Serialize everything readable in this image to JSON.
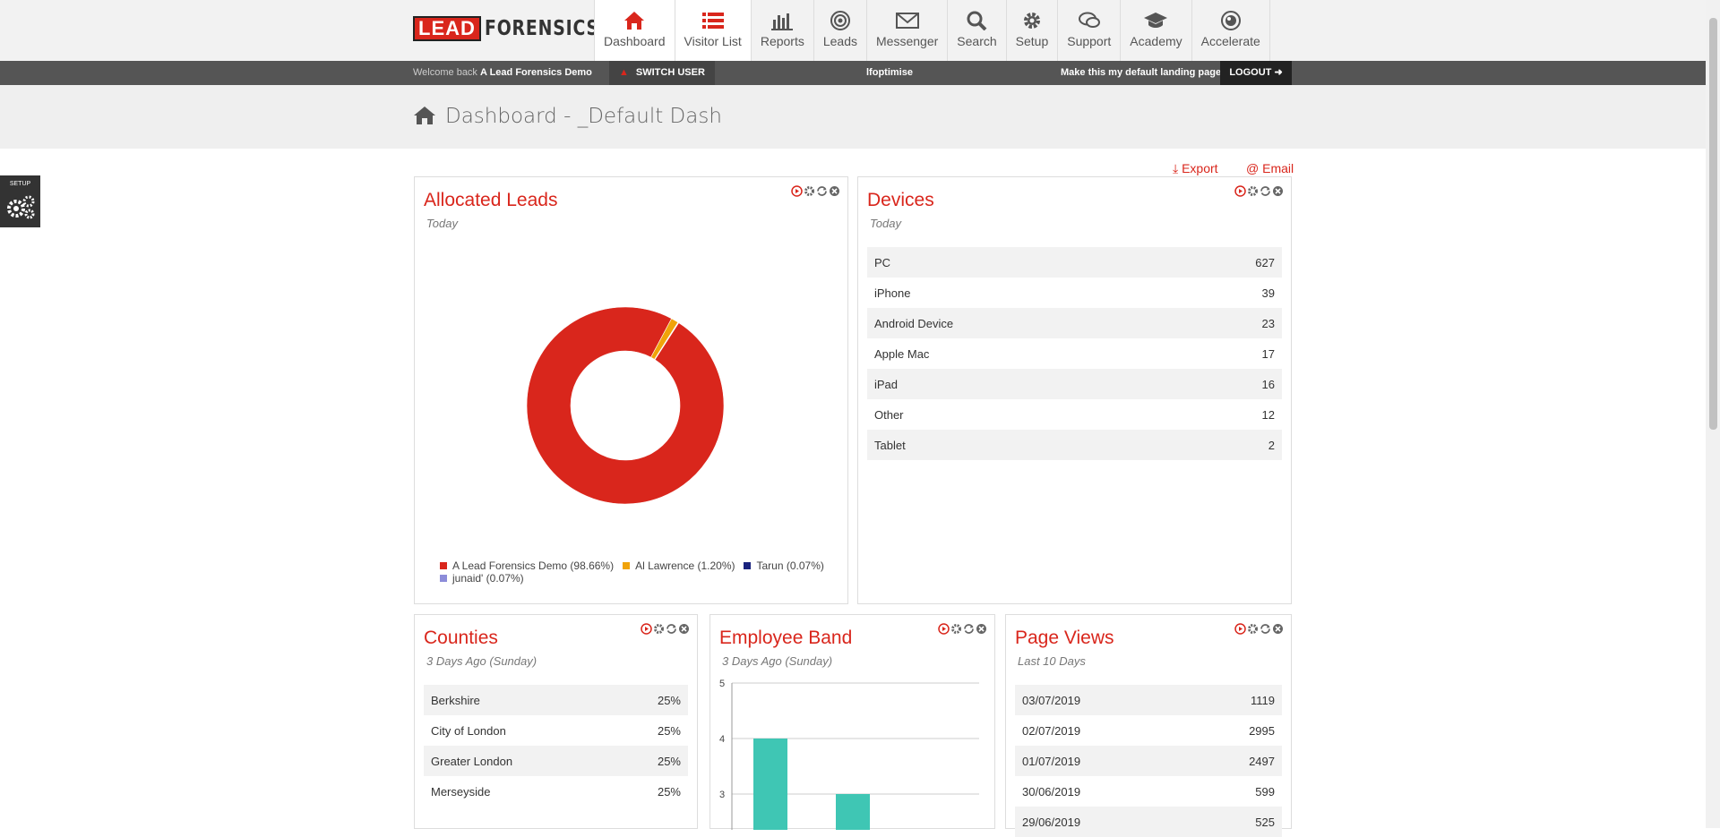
{
  "brand": {
    "logo_lead": "LEAD",
    "logo_forensics": "FORENSICS"
  },
  "nav": [
    {
      "label": "Dashboard",
      "icon": "home-icon"
    },
    {
      "label": "Visitor List",
      "icon": "list-icon"
    },
    {
      "label": "Reports",
      "icon": "bar-chart-icon"
    },
    {
      "label": "Leads",
      "icon": "target-icon"
    },
    {
      "label": "Messenger",
      "icon": "envelope-icon"
    },
    {
      "label": "Search",
      "icon": "search-icon"
    },
    {
      "label": "Setup",
      "icon": "gear-icon"
    },
    {
      "label": "Support",
      "icon": "chat-icon"
    },
    {
      "label": "Academy",
      "icon": "graduation-cap-icon"
    },
    {
      "label": "Accelerate",
      "icon": "accelerate-icon"
    }
  ],
  "userbar": {
    "welcome_prefix": "Welcome back",
    "account_name": "A Lead Forensics Demo",
    "switch_user": "SWITCH USER",
    "optimise": "lfoptimise",
    "default_landing": "Make this my default landing page",
    "logout": "LOGOUT"
  },
  "header": {
    "title": "Dashboard - _Default Dash"
  },
  "setup_tab": {
    "label": "SETUP"
  },
  "actions": {
    "export": "Export",
    "email": "@ Email"
  },
  "colors": {
    "brand_red": "#d9261c",
    "teal": "#3fc6b4",
    "orange": "#f0a30a",
    "navy": "#1a237e",
    "lavender": "#8c8cd9"
  },
  "allocated_leads": {
    "title": "Allocated Leads",
    "subtitle": "Today",
    "legend": [
      {
        "label": "A Lead Forensics Demo (98.66%)",
        "color": "#d9261c",
        "value": 98.66
      },
      {
        "label": "Al Lawrence (1.20%)",
        "color": "#f0a30a",
        "value": 1.2
      },
      {
        "label": "Tarun (0.07%)",
        "color": "#1a237e",
        "value": 0.07
      },
      {
        "label": "junaid' (0.07%)",
        "color": "#8c8cd9",
        "value": 0.07
      }
    ]
  },
  "devices": {
    "title": "Devices",
    "subtitle": "Today",
    "rows": [
      {
        "name": "PC",
        "value": "627"
      },
      {
        "name": "iPhone",
        "value": "39"
      },
      {
        "name": "Android Device",
        "value": "23"
      },
      {
        "name": "Apple Mac",
        "value": "17"
      },
      {
        "name": "iPad",
        "value": "16"
      },
      {
        "name": "Other",
        "value": "12"
      },
      {
        "name": "Tablet",
        "value": "2"
      }
    ]
  },
  "counties": {
    "title": "Counties",
    "subtitle": "3 Days Ago (Sunday)",
    "rows": [
      {
        "name": "Berkshire",
        "value": "25%"
      },
      {
        "name": "City of London",
        "value": "25%"
      },
      {
        "name": "Greater London",
        "value": "25%"
      },
      {
        "name": "Merseyside",
        "value": "25%"
      }
    ]
  },
  "employee_band": {
    "title": "Employee Band",
    "subtitle": "3 Days Ago (Sunday)"
  },
  "page_views": {
    "title": "Page Views",
    "subtitle": "Last 10 Days",
    "rows": [
      {
        "name": "03/07/2019",
        "value": "1119"
      },
      {
        "name": "02/07/2019",
        "value": "2995"
      },
      {
        "name": "01/07/2019",
        "value": "2497"
      },
      {
        "name": "30/06/2019",
        "value": "599"
      },
      {
        "name": "29/06/2019",
        "value": "525"
      }
    ]
  },
  "chart_data": {
    "type": "bar",
    "categories": [
      "",
      ""
    ],
    "values": [
      4,
      3
    ],
    "yticks": [
      "5",
      "4",
      "3"
    ],
    "ylim": [
      2,
      5
    ]
  }
}
